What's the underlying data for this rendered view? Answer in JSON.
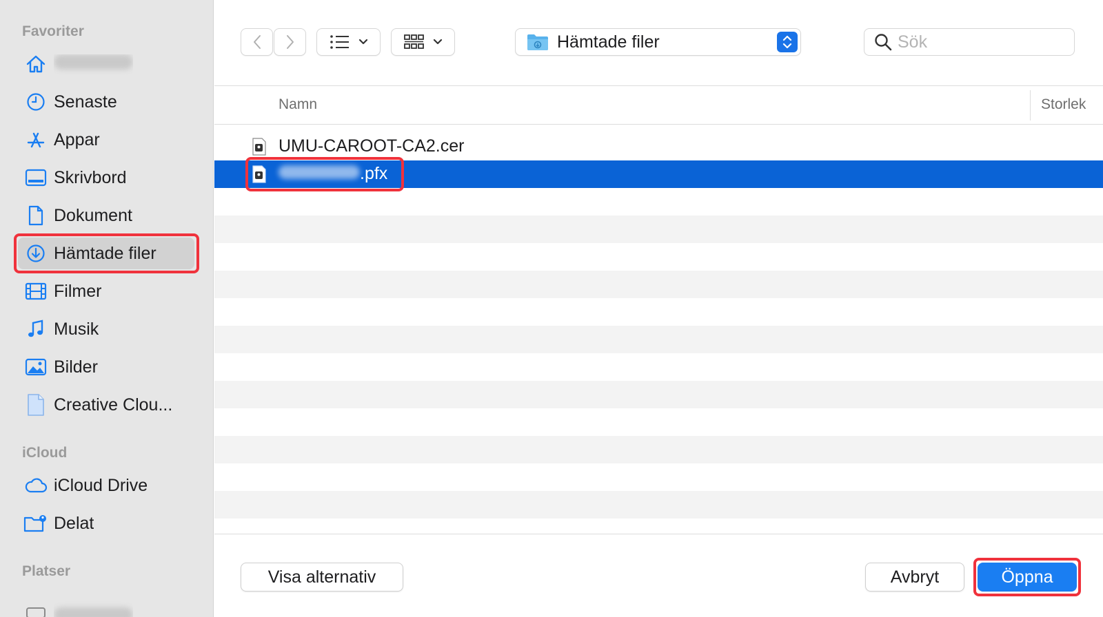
{
  "sidebar": {
    "sections": [
      {
        "title": "Favoriter"
      },
      {
        "title": "iCloud"
      },
      {
        "title": "Platser"
      }
    ],
    "favorites": [
      {
        "icon": "home-icon",
        "label": "",
        "label_blurred": true
      },
      {
        "icon": "clock-icon",
        "label": "Senaste"
      },
      {
        "icon": "appstore-icon",
        "label": "Appar"
      },
      {
        "icon": "desktop-icon",
        "label": "Skrivbord"
      },
      {
        "icon": "document-icon",
        "label": "Dokument"
      },
      {
        "icon": "download-icon",
        "label": "Hämtade filer",
        "selected": true,
        "highlighted": true
      },
      {
        "icon": "film-icon",
        "label": "Filmer"
      },
      {
        "icon": "music-note-icon",
        "label": "Musik"
      },
      {
        "icon": "photo-icon",
        "label": "Bilder"
      },
      {
        "icon": "file-icon",
        "label": "Creative Clou..."
      }
    ],
    "icloud": [
      {
        "icon": "cloud-icon",
        "label": "iCloud Drive"
      },
      {
        "icon": "shared-folder-icon",
        "label": "Delat"
      }
    ],
    "places": [
      {
        "icon": "disk-icon",
        "label": "",
        "label_blurred": true
      }
    ]
  },
  "toolbar": {
    "back_icon": "chevron-left-icon",
    "forward_icon": "chevron-right-icon",
    "list_view_icon": "list-icon",
    "grid_view_icon": "grid-icon",
    "location": "Hämtade filer",
    "location_icon": "downloads-folder-icon",
    "search_placeholder": "Sök"
  },
  "list": {
    "columns": {
      "name": "Namn",
      "size": "Storlek"
    },
    "files": [
      {
        "name": "UMU-CAROOT-CA2.cer",
        "icon": "certificate-file-icon",
        "selected": false
      },
      {
        "name": ".pfx",
        "name_prefix_blurred": true,
        "icon": "certificate-file-icon",
        "selected": true,
        "highlighted": true
      }
    ]
  },
  "footer": {
    "options_label": "Visa alternativ",
    "cancel_label": "Avbryt",
    "open_label": "Öppna",
    "open_highlighted": true
  },
  "colors": {
    "accent": "#1a7ef2",
    "selection": "#0a63d6",
    "highlight_border": "#f0323c",
    "sidebar_bg": "#e6e6e6"
  }
}
